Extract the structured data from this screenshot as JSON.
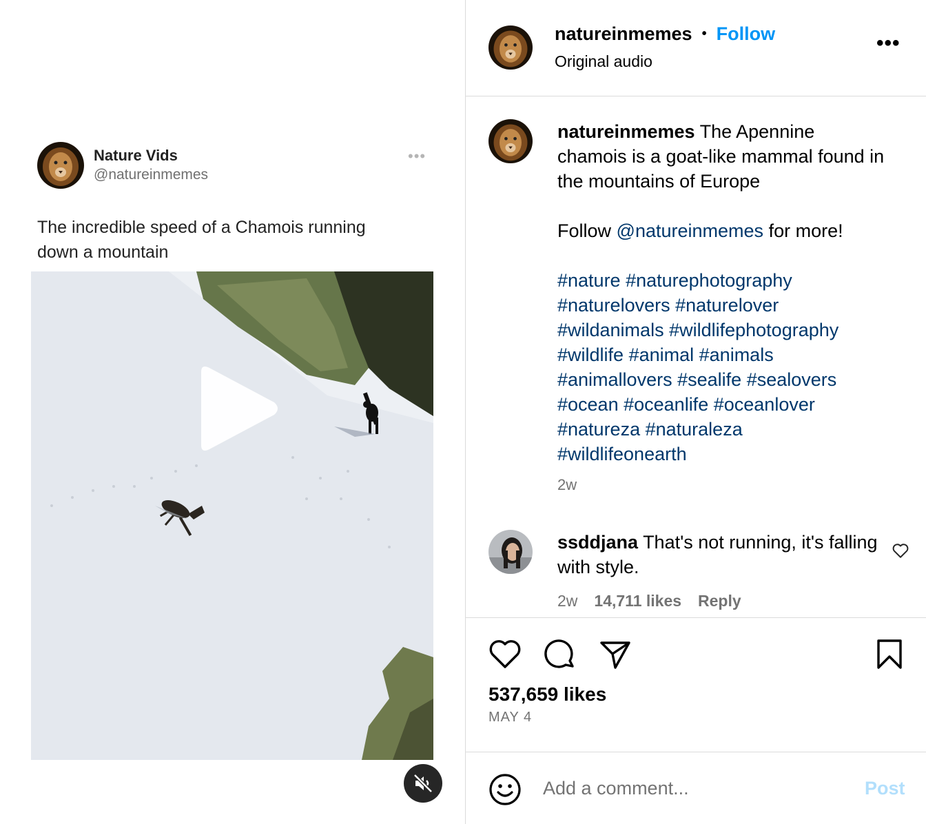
{
  "tweet": {
    "name": "Nature Vids",
    "handle": "@natureinmemes",
    "more_icon": "ellipsis-icon",
    "text": "The incredible speed of a Chamois running down a mountain"
  },
  "video": {
    "play_icon": "play-icon",
    "mute_icon": "muted-speaker-icon"
  },
  "header": {
    "username": "natureinmemes",
    "separator": "•",
    "follow_label": "Follow",
    "audio": "Original audio",
    "more_label": "•••"
  },
  "caption": {
    "username": "natureinmemes",
    "text": "The Apennine chamois is a goat-like mammal found in the mountains of Europe",
    "follow_prefix": "Follow",
    "mention": "@natureinmemes",
    "follow_suffix": "for more!",
    "hashtags": [
      "#nature",
      "#naturephotography",
      "#naturelovers",
      "#naturelover",
      "#wildanimals",
      "#wildlifephotography",
      "#wildlife",
      "#animal",
      "#animals",
      "#animallovers",
      "#sealife",
      "#sealovers",
      "#ocean",
      "#oceanlife",
      "#oceanlover",
      "#natureza",
      "#naturaleza",
      "#wildlifeonearth"
    ],
    "time": "2w"
  },
  "comment": {
    "username": "ssddjana",
    "text": "That's not running, it's falling with style.",
    "time": "2w",
    "likes": "14,711 likes",
    "reply_label": "Reply"
  },
  "actions": {
    "icons": [
      "heart-icon",
      "comment-icon",
      "share-icon",
      "bookmark-icon"
    ],
    "likes": "537,659 likes",
    "date": "MAY 4"
  },
  "comment_box": {
    "placeholder": "Add a comment...",
    "post_label": "Post"
  },
  "colors": {
    "follow": "#0095f6",
    "link": "#00376b",
    "post_disabled": "#b2dffc",
    "muted_text": "#737373"
  }
}
